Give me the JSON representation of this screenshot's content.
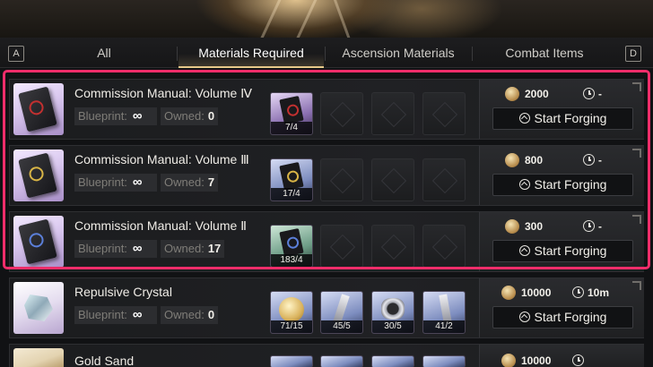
{
  "tabs": {
    "left_key": "A",
    "right_key": "D",
    "items": [
      {
        "label": "All"
      },
      {
        "label": "Materials Required"
      },
      {
        "label": "Ascension Materials"
      },
      {
        "label": "Combat Items"
      }
    ],
    "active_index": 1
  },
  "labels": {
    "blueprint": "Blueprint:",
    "blueprint_value": "∞",
    "owned": "Owned:",
    "forge_button": "Start Forging"
  },
  "items": [
    {
      "name": "Commission Manual: Volume Ⅳ",
      "owned": "0",
      "materials": [
        {
          "qty": "7/4",
          "icon": "commission-manual-red-icon"
        }
      ],
      "cost": "2000",
      "time": "-"
    },
    {
      "name": "Commission Manual: Volume Ⅲ",
      "owned": "7",
      "materials": [
        {
          "qty": "17/4",
          "icon": "commission-manual-gold-icon"
        }
      ],
      "cost": "800",
      "time": "-"
    },
    {
      "name": "Commission Manual: Volume Ⅱ",
      "owned": "17",
      "materials": [
        {
          "qty": "183/4",
          "icon": "commission-manual-blue-icon"
        }
      ],
      "cost": "300",
      "time": "-"
    },
    {
      "name": "Repulsive Crystal",
      "owned": "0",
      "materials": [
        {
          "qty": "71/15",
          "icon": "gold-coin-icon"
        },
        {
          "qty": "45/5",
          "icon": "blade-icon"
        },
        {
          "qty": "30/5",
          "icon": "ring-icon"
        },
        {
          "qty": "41/2",
          "icon": "shard-icon"
        }
      ],
      "cost": "10000",
      "time": "10m"
    },
    {
      "name": "Gold Sand",
      "cost": "10000"
    }
  ],
  "colors": {
    "highlight": "#ef2d6a",
    "active_tab_underline": "#e7c98a"
  }
}
